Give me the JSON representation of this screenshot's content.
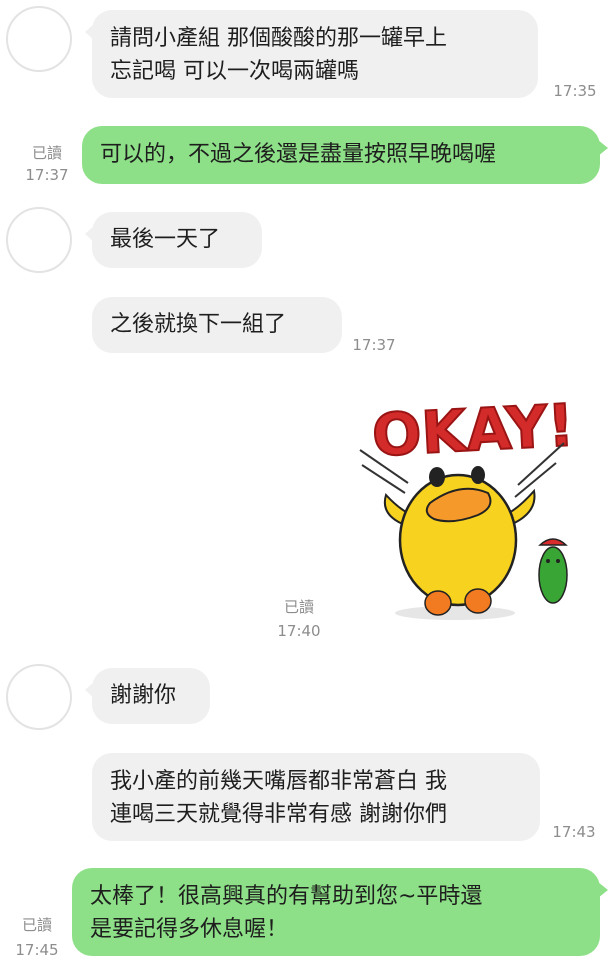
{
  "messages": {
    "m1": {
      "text": "請問小產組 那個酸酸的那一罐早上\n忘記喝 可以一次喝兩罐嗎",
      "time": "17:35"
    },
    "m2": {
      "read": "已讀",
      "time": "17:37",
      "text": "可以的，不過之後還是盡量按照早晚喝喔"
    },
    "m3": {
      "text": "最後一天了"
    },
    "m4": {
      "text": "之後就換下一組了",
      "time": "17:37"
    },
    "sticker": {
      "text": "OKAY!",
      "read": "已讀",
      "time": "17:40"
    },
    "m5": {
      "text": "謝謝你"
    },
    "m6": {
      "text": "我小產的前幾天嘴唇都非常蒼白 我\n連喝三天就覺得非常有感 謝謝你們",
      "time": "17:43"
    },
    "m7": {
      "read": "已讀",
      "time": "17:45",
      "text": "太棒了！很高興真的有幫助到您~平時還\n是要記得多休息喔！"
    }
  },
  "colors": {
    "outgoing": "#8de087",
    "incoming": "#f0f0f0",
    "meta": "#8d8d8d"
  }
}
